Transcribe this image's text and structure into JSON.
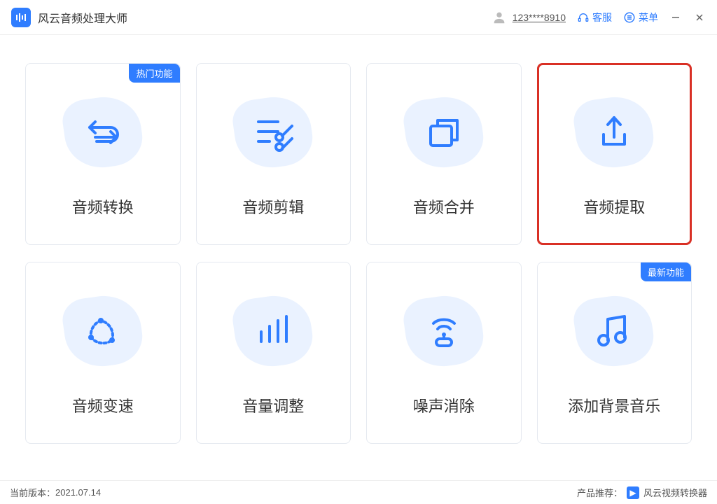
{
  "header": {
    "app_title": "风云音频处理大师",
    "user_id": "123****8910",
    "support_label": "客服",
    "menu_label": "菜单"
  },
  "badges": {
    "hot": "热门功能",
    "new": "最新功能"
  },
  "cards": [
    {
      "label": "音频转换"
    },
    {
      "label": "音频剪辑"
    },
    {
      "label": "音频合并"
    },
    {
      "label": "音频提取"
    },
    {
      "label": "音频变速"
    },
    {
      "label": "音量调整"
    },
    {
      "label": "噪声消除"
    },
    {
      "label": "添加背景音乐"
    }
  ],
  "footer": {
    "version_label": "当前版本：",
    "version_value": "2021.07.14",
    "recommend_label": "产品推荐：",
    "recommend_product": "风云视频转换器"
  }
}
